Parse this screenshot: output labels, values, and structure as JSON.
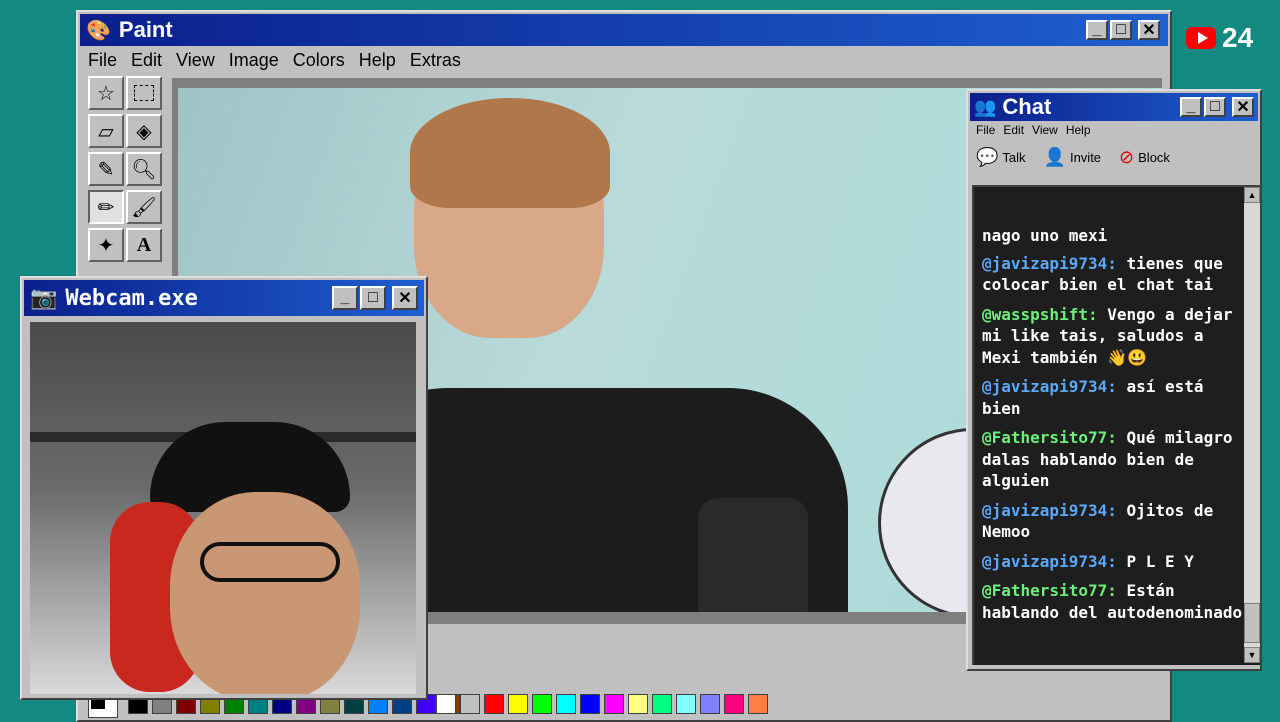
{
  "paint": {
    "title": "Paint",
    "menu": [
      "File",
      "Edit",
      "View",
      "Image",
      "Colors",
      "Help",
      "Extras"
    ],
    "tools": [
      "free-select",
      "rect-select",
      "eraser",
      "fill",
      "color-picker",
      "magnifier",
      "pencil",
      "brush",
      "airbrush",
      "text"
    ],
    "palette": [
      "#000000",
      "#808080",
      "#800000",
      "#808000",
      "#008000",
      "#008080",
      "#000080",
      "#800080",
      "#808040",
      "#004040",
      "#0080ff",
      "#004080",
      "#4000ff",
      "#804000",
      "#ffffff",
      "#c0c0c0",
      "#ff0000",
      "#ffff00",
      "#00ff00",
      "#00ffff",
      "#0000ff",
      "#ff00ff",
      "#ffff80",
      "#00ff80",
      "#80ffff",
      "#8080ff",
      "#ff0080",
      "#ff8040"
    ]
  },
  "badge": {
    "count": "24",
    "color": "#ff0000"
  },
  "webcam": {
    "title": "Webcam.exe"
  },
  "chat": {
    "title": "Chat",
    "menu": [
      "File",
      "Edit",
      "View",
      "Help"
    ],
    "toolbar": {
      "talk": "Talk",
      "invite": "Invite",
      "block": "Block"
    },
    "messages": [
      {
        "user": "",
        "text": "nago uno mexi",
        "color": "#ffffff"
      },
      {
        "user": "@javizapi9734:",
        "text": "tienes que colocar bien el chat tai",
        "color": "#5aa9ff"
      },
      {
        "user": "@wasspshift:",
        "text": "Vengo a dejar mi like tais, saludos a Mexi también 👋😃",
        "color": "#6cf07a"
      },
      {
        "user": "@javizapi9734:",
        "text": "así está bien",
        "color": "#5aa9ff"
      },
      {
        "user": "@Fathersito77:",
        "text": "Qué milagro dalas hablando bien de alguien",
        "color": "#6cf07a"
      },
      {
        "user": "@javizapi9734:",
        "text": "Ojitos de Nemoo",
        "color": "#5aa9ff"
      },
      {
        "user": "@javizapi9734:",
        "text": "P L E Y",
        "color": "#5aa9ff"
      },
      {
        "user": "@Fathersito77:",
        "text": "Están hablando del autodenominado rey de lo",
        "color": "#6cf07a"
      }
    ]
  }
}
